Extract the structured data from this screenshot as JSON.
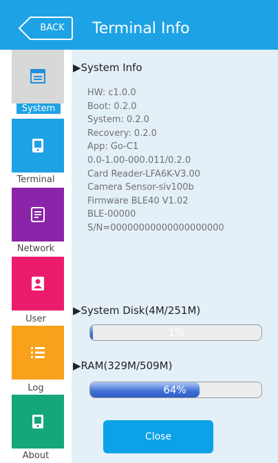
{
  "header": {
    "back_label": "BACK",
    "title": "Terminal Info"
  },
  "sidebar": {
    "items": [
      {
        "label": "System",
        "color": "#d8d8d8",
        "icon": "system-icon",
        "active": true
      },
      {
        "label": "Terminal",
        "color": "#1da2e6",
        "icon": "terminal-icon"
      },
      {
        "label": "Network",
        "color": "#8a24a8",
        "icon": "network-icon"
      },
      {
        "label": "User",
        "color": "#ec1c6c",
        "icon": "user-icon"
      },
      {
        "label": "Log",
        "color": "#f9a11b",
        "icon": "log-icon"
      },
      {
        "label": "About",
        "color": "#15a67a",
        "icon": "about-icon"
      }
    ]
  },
  "system_info": {
    "heading": "▶System Info",
    "lines": [
      "HW: c1.0.0",
      "Boot: 0.2.0",
      "System: 0.2.0",
      "Recovery: 0.2.0",
      "App: Go-C1",
      "0.0-1.00-000.011/0.2.0",
      "Card Reader-LFA6K-V3.00",
      "Camera Sensor-siv100b",
      "Firmware BLE40 V1.02",
      "BLE-00000",
      "S/N=00000000000000000000"
    ]
  },
  "disk": {
    "heading": "▶System Disk(4M/251M)",
    "percent_label": "1%",
    "fraction": 0.016
  },
  "ram": {
    "heading": "▶RAM(329M/509M)",
    "percent_label": "64%",
    "fraction": 0.64
  },
  "close_label": "Close",
  "colors": {
    "header": "#1da2e6",
    "panel": "#e4f0f8",
    "button": "#0ba2ea"
  }
}
